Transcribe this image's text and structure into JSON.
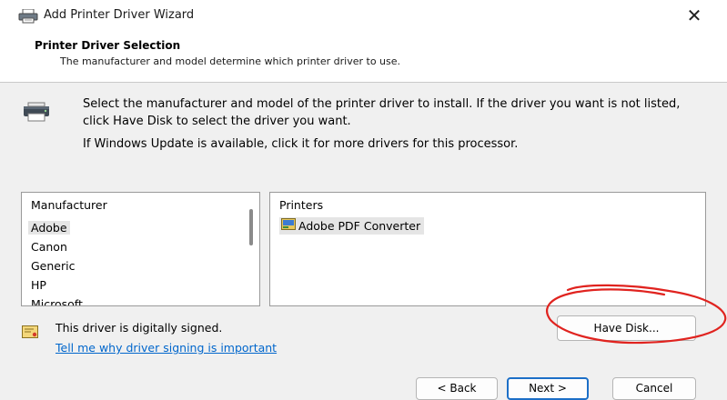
{
  "window": {
    "title": "Add Printer Driver Wizard",
    "close_symbol": "✕"
  },
  "header": {
    "title": "Printer Driver Selection",
    "subtitle": "The manufacturer and model determine which printer driver to use."
  },
  "content": {
    "description": "Select the manufacturer and model of the printer driver to install. If the driver you want is not listed, click Have Disk to select the driver you want.",
    "windows_update_note": "If Windows Update is available, click it for more drivers for this processor."
  },
  "manufacturer_list": {
    "header": "Manufacturer",
    "items": [
      "Adobe",
      "Canon",
      "Generic",
      "HP",
      "Microsoft"
    ],
    "selected": "Adobe"
  },
  "printers_list": {
    "header": "Printers",
    "items": [
      "Adobe PDF Converter"
    ]
  },
  "signing": {
    "status": "This driver is digitally signed.",
    "link": "Tell me why driver signing is important"
  },
  "buttons": {
    "have_disk": "Have Disk...",
    "back": "< Back",
    "next": "Next >",
    "cancel": "Cancel"
  },
  "colors": {
    "link": "#0066cc",
    "annotation": "#e0231f",
    "default_button_border": "#1c6fc7"
  },
  "icons": [
    "printer-icon",
    "certificate-icon",
    "printer-driver-icon"
  ]
}
